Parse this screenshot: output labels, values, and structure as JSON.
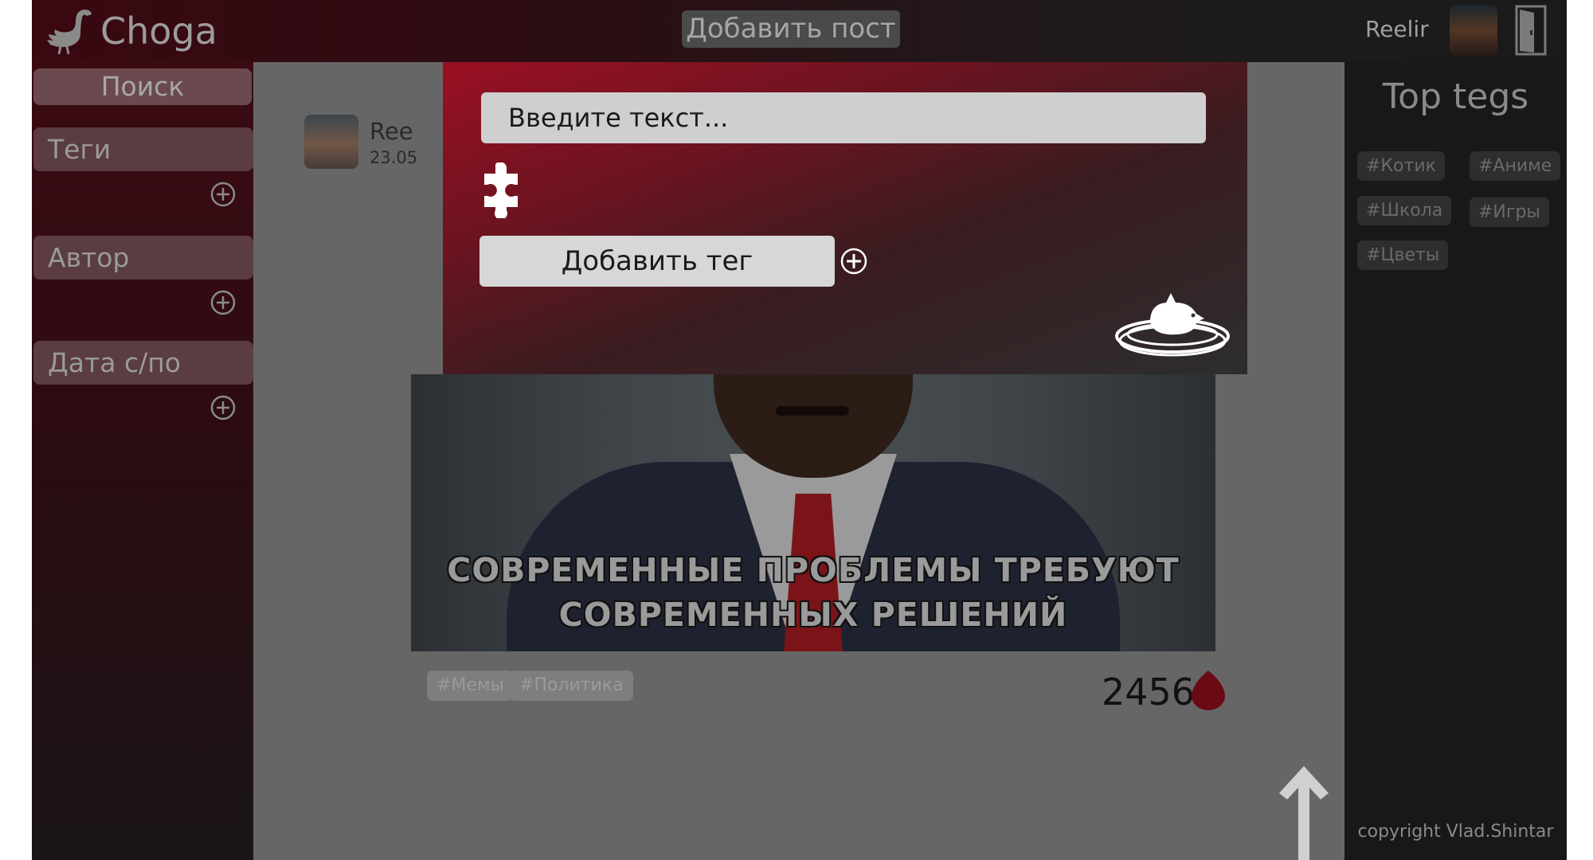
{
  "header": {
    "app_name": "Choga",
    "add_post_label": "Добавить пост",
    "username": "Reelir"
  },
  "sidebar": {
    "search_label": "Поиск",
    "sections": [
      {
        "label": "Теги"
      },
      {
        "label": "Автор"
      },
      {
        "label": "Дата с/по"
      }
    ]
  },
  "post": {
    "author_partial": "Ree",
    "date_partial": "23.05",
    "caption_line1": "СОВРЕМЕННЫЕ ПРОБЛЕМЫ ТРЕБУЮТ",
    "caption_line2": "СОВРЕМЕННЫХ РЕШЕНИЙ",
    "tags": [
      "#Мемы",
      "#Политика"
    ],
    "likes": "2456"
  },
  "right_sidebar": {
    "title": "Top tegs",
    "tags": [
      "#Котик",
      "#Аниме",
      "#Школа",
      "#Игры",
      "#Цветы"
    ],
    "copyright": "copyright Vlad.Shintar"
  },
  "modal": {
    "text_placeholder": "Введите текст...",
    "add_tag_label": "Добавить тег"
  },
  "icons": {
    "logo": "goose-icon",
    "logout": "door-icon",
    "add": "plus-circle-icon",
    "tag": "puzzle-icon",
    "submit": "nest-icon",
    "like": "drop-icon",
    "scroll": "arrow-up-icon"
  },
  "colors": {
    "accent": "#9a1022",
    "like": "#6a0a14"
  }
}
